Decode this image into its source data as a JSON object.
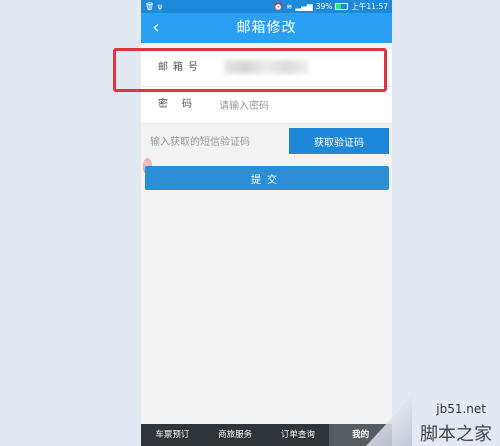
{
  "status_bar": {
    "left_icons": [
      "delete-icon",
      "usb-icon"
    ],
    "battery": "39%",
    "time": "上午11:57"
  },
  "nav": {
    "title": "邮箱修改",
    "back_icon": "chevron-left-icon"
  },
  "form": {
    "email_label": "邮箱号",
    "email_value": "",
    "password_label": "密码",
    "password_placeholder": "请输入密码",
    "sms_placeholder": "输入获取的短信验证码",
    "sms_button": "获取验证码",
    "submit_button": "提交"
  },
  "tabs": [
    {
      "label": "车票预订"
    },
    {
      "label": "商旅服务"
    },
    {
      "label": "订单查询"
    },
    {
      "label": "我的"
    }
  ],
  "watermark": {
    "domain": "jb51.net",
    "brand": "脚本之家"
  },
  "colors": {
    "nav": "#2aa0f3",
    "status": "#1e88d9",
    "button": "#2c8fd6",
    "highlight": "#e0343f",
    "tabbar": "#2f3439"
  }
}
